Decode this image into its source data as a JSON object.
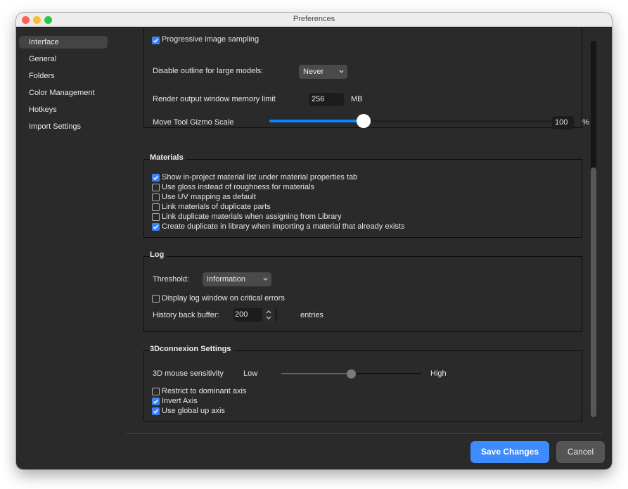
{
  "window": {
    "title": "Preferences",
    "traffic_lights": [
      "close",
      "minimize",
      "zoom"
    ]
  },
  "sidebar": {
    "active": "Interface",
    "items": [
      {
        "label": "Interface"
      },
      {
        "label": "General"
      },
      {
        "label": "Folders"
      },
      {
        "label": "Color Management"
      },
      {
        "label": "Hotkeys"
      },
      {
        "label": "Import Settings"
      }
    ]
  },
  "interface_group": {
    "progressive_label": "Progressive image sampling",
    "progressive_checked": true,
    "disable_outline": {
      "label": "Disable outline for large models:",
      "value": "Never"
    },
    "render_memory": {
      "label": "Render output window memory limit",
      "value": "256",
      "unit": "MB"
    },
    "gizmo_scale": {
      "label": "Move Tool Gizmo Scale",
      "value": "100",
      "unit": "%",
      "slider_fraction": 0.33
    }
  },
  "materials": {
    "title": "Materials",
    "options": [
      {
        "label": "Show in-project material list under material properties tab",
        "checked": true
      },
      {
        "label": "Use gloss instead of roughness for materials",
        "checked": false
      },
      {
        "label": "Use UV mapping as default",
        "checked": false
      },
      {
        "label": "Link materials of duplicate parts",
        "checked": false
      },
      {
        "label": "Link duplicate materials when assigning from Library",
        "checked": false
      },
      {
        "label": "Create duplicate in library when importing a material that already exists",
        "checked": true
      }
    ]
  },
  "log": {
    "title": "Log",
    "threshold": {
      "label": "Threshold:",
      "value": "Information"
    },
    "display_on_errors": {
      "label": "Display log window on critical errors",
      "checked": false
    },
    "history": {
      "label": "History back buffer:",
      "value": "200",
      "unit": "entries"
    }
  },
  "connexion": {
    "title": "3Dconnexion Settings",
    "sensitivity": {
      "label": "3D mouse sensitivity",
      "low": "Low",
      "high": "High",
      "fraction": 0.5
    },
    "options": [
      {
        "label": "Restrict to dominant axis",
        "checked": false
      },
      {
        "label": "Invert Axis",
        "checked": true
      },
      {
        "label": "Use global up axis",
        "checked": true
      }
    ]
  },
  "footer": {
    "save_label": "Save Changes",
    "cancel_label": "Cancel"
  },
  "colors": {
    "accent": "#3d8bfd",
    "checkbox_on": "#3b82f6",
    "background": "#2a2a2a"
  }
}
